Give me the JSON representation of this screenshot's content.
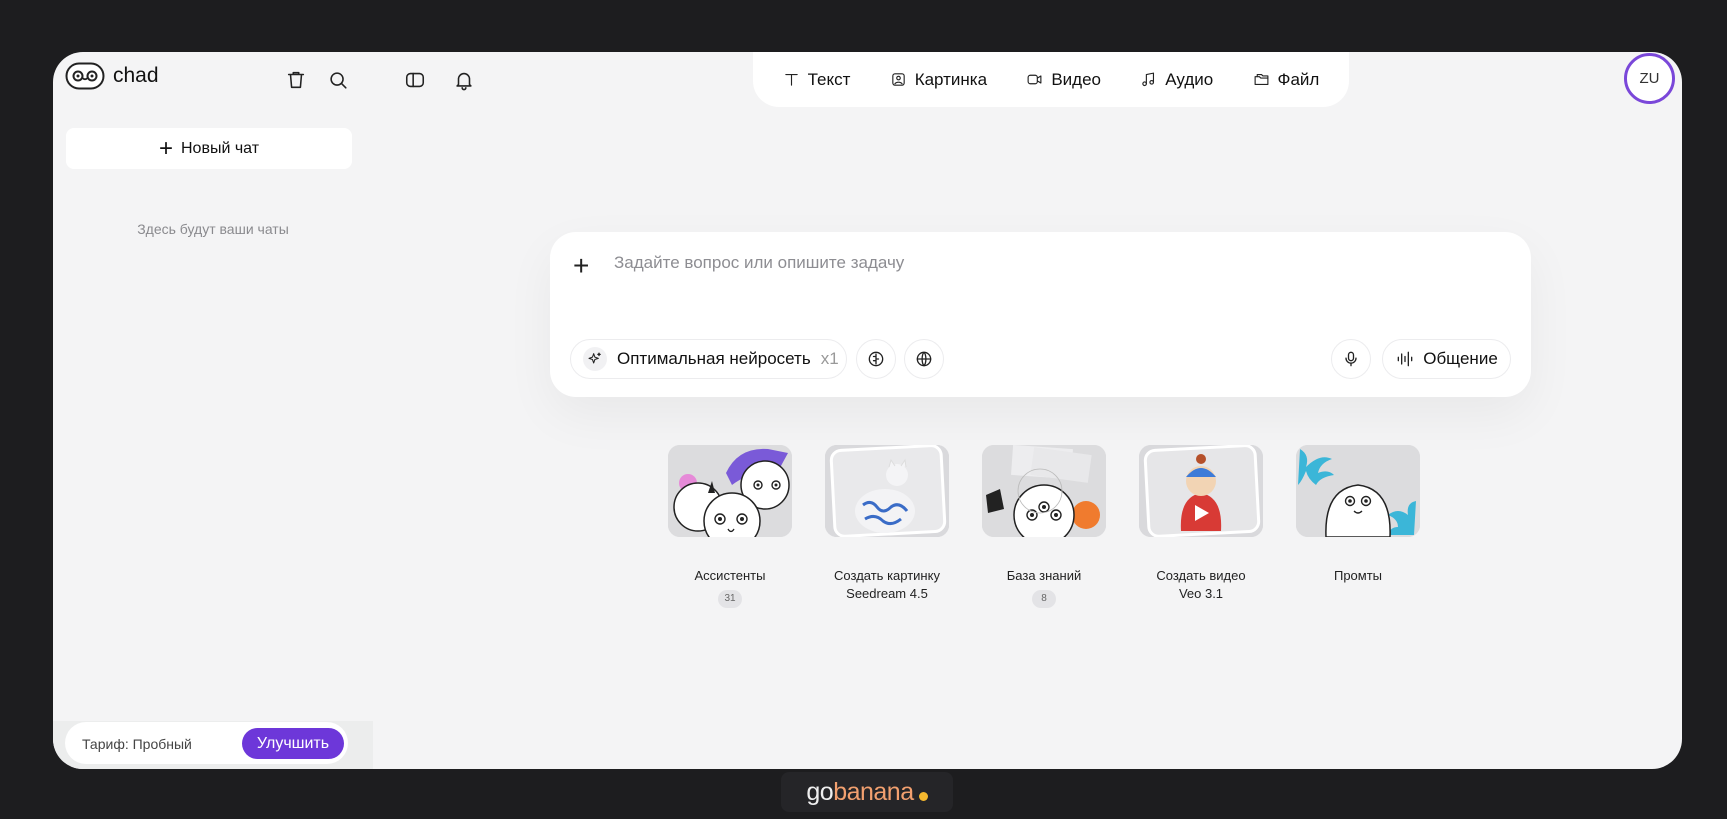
{
  "app": {
    "name": "chad"
  },
  "sidebar": {
    "new_chat_label": "Новый чат",
    "empty_text": "Здесь будут ваши чаты",
    "plan_text": "Тариф: Пробный",
    "upgrade_label": "Улучшить"
  },
  "toolbar": {
    "icons": [
      "trash-icon",
      "search-icon",
      "sidebar-toggle-icon",
      "bell-icon"
    ]
  },
  "modes": [
    {
      "label": "Текст",
      "icon": "text-icon"
    },
    {
      "label": "Картинка",
      "icon": "image-icon"
    },
    {
      "label": "Видео",
      "icon": "video-icon"
    },
    {
      "label": "Аудио",
      "icon": "music-icon"
    },
    {
      "label": "Файл",
      "icon": "folder-icon"
    }
  ],
  "user": {
    "initials": "ZU"
  },
  "composer": {
    "placeholder": "Задайте вопрос или опишите задачу",
    "model_label": "Оптимальная нейросеть",
    "model_multiplier": "x1",
    "talk_label": "Общение"
  },
  "cards": [
    {
      "title": "Ассистенты",
      "badge": "31"
    },
    {
      "title": "Создать картинку",
      "subtitle": "Seedream 4.5"
    },
    {
      "title": "База знаний",
      "badge": "8"
    },
    {
      "title": "Создать видео",
      "subtitle": "Veo 3.1"
    },
    {
      "title": "Промты"
    }
  ],
  "footer": {
    "brand_go": "go",
    "brand_banana": "banana"
  },
  "colors": {
    "accent": "#6d37d9",
    "avatar_ring": "#7a47d9",
    "page_bg": "#1d1d1f",
    "app_bg": "#f4f4f5"
  }
}
